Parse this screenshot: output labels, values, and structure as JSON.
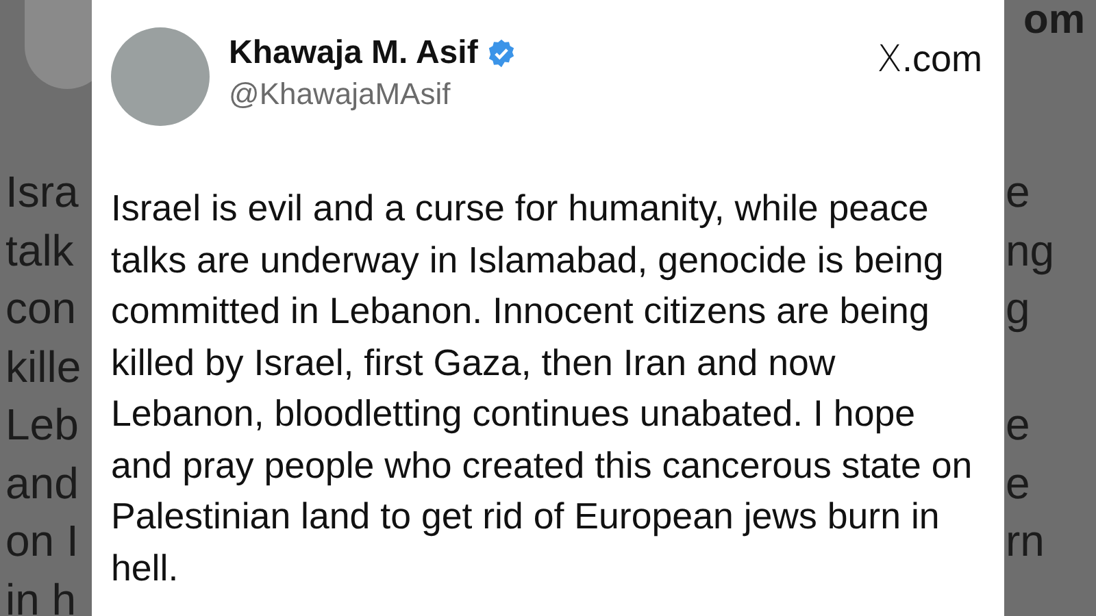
{
  "background": {
    "top_right_fragment": "om",
    "rows": [
      {
        "left": "Isra",
        "right": "e"
      },
      {
        "left": "talk",
        "right": "ng"
      },
      {
        "left": "con",
        "right": "g"
      },
      {
        "left": "kille"
      },
      {
        "left": "Leb",
        "right": "e"
      },
      {
        "left": "and",
        "right": "e"
      },
      {
        "left": "on I",
        "right": "rn"
      },
      {
        "left": "in h"
      }
    ]
  },
  "post": {
    "author": {
      "name": "Khawaja M. Asif",
      "verified": true,
      "handle": "@KhawajaMAsif"
    },
    "site": "X.com",
    "text": "Israel is evil and a curse for humanity, while peace talks are underway in Islamabad, genocide is being committed in Lebanon. Innocent citizens are being killed by Israel, first Gaza, then Iran and now Lebanon, bloodletting continues unabated. I hope and pray people who created this cancerous state on Palestinian land to get rid of European jews burn in hell."
  }
}
